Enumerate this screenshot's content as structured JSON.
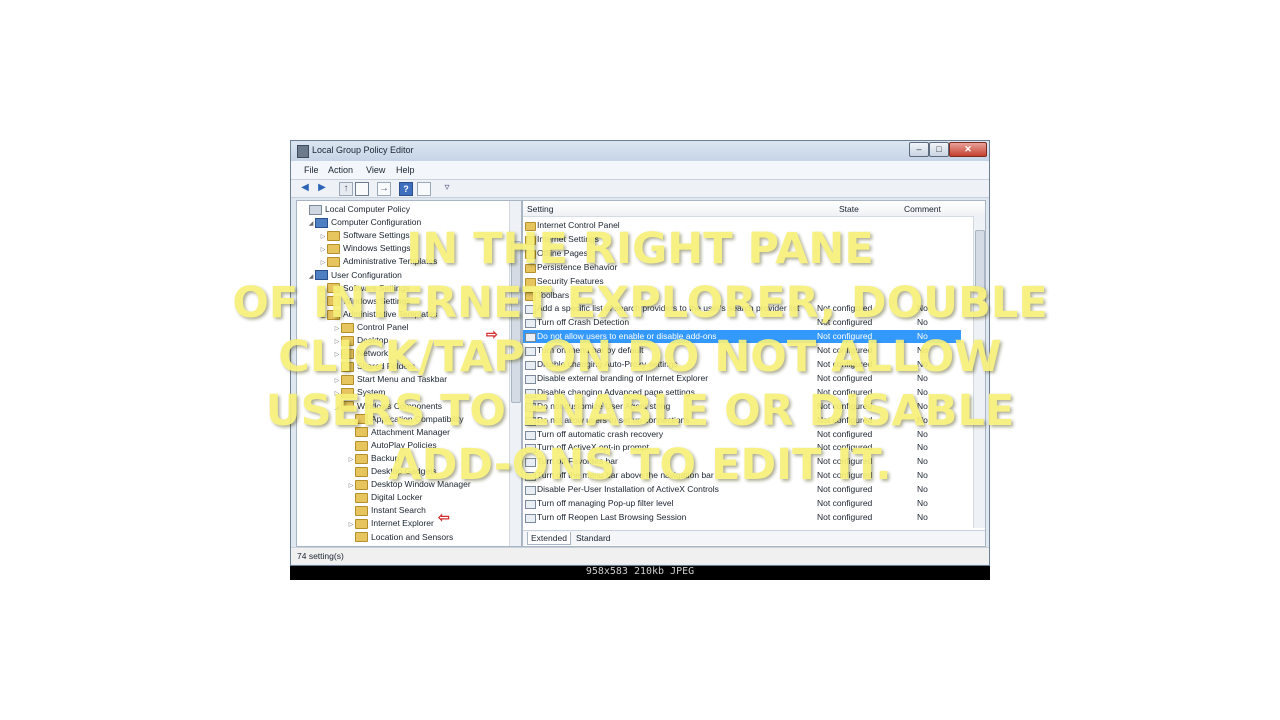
{
  "window": {
    "title": "Local Group Policy Editor",
    "controls": {
      "minimize": "–",
      "maximize": "□",
      "close": "✕"
    }
  },
  "menubar": {
    "items": [
      "File",
      "Action",
      "View",
      "Help"
    ]
  },
  "toolbar": {
    "icons": [
      "back-arrow-icon",
      "forward-arrow-icon",
      "up-folder-icon",
      "show-hide-tree-icon",
      "export-list-icon",
      "help-icon",
      "view-icon",
      "filter-icon"
    ]
  },
  "tree": {
    "nodes": [
      {
        "label": "Local Computer Policy",
        "expander": "",
        "icon": "policy"
      },
      {
        "label": "Computer Configuration",
        "expander": "◢",
        "icon": "computer"
      },
      {
        "label": "Software Settings",
        "expander": "▷",
        "icon": "folder"
      },
      {
        "label": "Windows Settings",
        "expander": "▷",
        "icon": "folder"
      },
      {
        "label": "Administrative Templates",
        "expander": "▷",
        "icon": "folder"
      },
      {
        "label": "User Configuration",
        "expander": "◢",
        "icon": "computer"
      },
      {
        "label": "Software Settings",
        "expander": "▷",
        "icon": "folder"
      },
      {
        "label": "Windows Settings",
        "expander": "▷",
        "icon": "folder"
      },
      {
        "label": "Administrative Templates",
        "expander": "◢",
        "icon": "folder"
      },
      {
        "label": "Control Panel",
        "expander": "▷",
        "icon": "folder"
      },
      {
        "label": "Desktop",
        "expander": "▷",
        "icon": "folder"
      },
      {
        "label": "Network",
        "expander": "▷",
        "icon": "folder"
      },
      {
        "label": "Shared Folders",
        "expander": "",
        "icon": "folder"
      },
      {
        "label": "Start Menu and Taskbar",
        "expander": "▷",
        "icon": "folder"
      },
      {
        "label": "System",
        "expander": "▷",
        "icon": "folder"
      },
      {
        "label": "Windows Components",
        "expander": "◢",
        "icon": "folder"
      },
      {
        "label": "Application Compatibility",
        "expander": "",
        "icon": "folder"
      },
      {
        "label": "Attachment Manager",
        "expander": "",
        "icon": "folder"
      },
      {
        "label": "AutoPlay Policies",
        "expander": "",
        "icon": "folder"
      },
      {
        "label": "Backup",
        "expander": "▷",
        "icon": "folder"
      },
      {
        "label": "Desktop Gadgets",
        "expander": "",
        "icon": "folder"
      },
      {
        "label": "Desktop Window Manager",
        "expander": "▷",
        "icon": "folder"
      },
      {
        "label": "Digital Locker",
        "expander": "",
        "icon": "folder"
      },
      {
        "label": "Instant Search",
        "expander": "",
        "icon": "folder"
      },
      {
        "label": "Internet Explorer",
        "expander": "▷",
        "icon": "folder"
      },
      {
        "label": "Location and Sensors",
        "expander": "",
        "icon": "folder"
      }
    ]
  },
  "list": {
    "headers": {
      "setting": "Setting",
      "state": "State",
      "comment": "Comment"
    },
    "rows": [
      {
        "setting": "Internet Control Panel",
        "state": "",
        "comment": "",
        "type": "folder"
      },
      {
        "setting": "Internet Settings",
        "state": "",
        "comment": "",
        "type": "folder"
      },
      {
        "setting": "Offline Pages",
        "state": "",
        "comment": "",
        "type": "folder"
      },
      {
        "setting": "Persistence Behavior",
        "state": "",
        "comment": "",
        "type": "folder"
      },
      {
        "setting": "Security Features",
        "state": "",
        "comment": "",
        "type": "folder"
      },
      {
        "setting": "Toolbars",
        "state": "",
        "comment": "",
        "type": "folder"
      },
      {
        "setting": "Add a specific list of search providers to the user's search provider list",
        "state": "Not configured",
        "comment": "No",
        "type": "setting"
      },
      {
        "setting": "Turn off Crash Detection",
        "state": "Not configured",
        "comment": "No",
        "type": "setting"
      },
      {
        "setting": "Do not allow users to enable or disable add-ons",
        "state": "Not configured",
        "comment": "No",
        "type": "setting",
        "selected": true
      },
      {
        "setting": "Turn on menu bar by default",
        "state": "Not configured",
        "comment": "No",
        "type": "setting"
      },
      {
        "setting": "Disable changing Auto-Proxy settings",
        "state": "Not configured",
        "comment": "No",
        "type": "setting"
      },
      {
        "setting": "Disable external branding of Internet Explorer",
        "state": "Not configured",
        "comment": "No",
        "type": "setting"
      },
      {
        "setting": "Disable changing Advanced page settings",
        "state": "Not configured",
        "comment": "No",
        "type": "setting"
      },
      {
        "setting": "Do not customize User Agent string",
        "state": "Not configured",
        "comment": "No",
        "type": "setting"
      },
      {
        "setting": "Do not allow users to set up connections",
        "state": "Not configured",
        "comment": "No",
        "type": "setting"
      },
      {
        "setting": "Turn off automatic crash recovery",
        "state": "Not configured",
        "comment": "No",
        "type": "setting"
      },
      {
        "setting": "Turn off ActiveX opt-in prompt",
        "state": "Not configured",
        "comment": "No",
        "type": "setting"
      },
      {
        "setting": "Turn off Favorites bar",
        "state": "Not configured",
        "comment": "No",
        "type": "setting"
      },
      {
        "setting": "Turn off the menu bar above the navigation bar",
        "state": "Not configured",
        "comment": "No",
        "type": "setting"
      },
      {
        "setting": "Disable Per-User Installation of ActiveX Controls",
        "state": "Not configured",
        "comment": "No",
        "type": "setting"
      },
      {
        "setting": "Turn off managing Pop-up filter level",
        "state": "Not configured",
        "comment": "No",
        "type": "setting"
      },
      {
        "setting": "Turn off Reopen Last Browsing Session",
        "state": "Not configured",
        "comment": "No",
        "type": "setting"
      }
    ],
    "tabs": [
      "Extended",
      "Standard"
    ]
  },
  "status": {
    "text": "74 setting(s)"
  },
  "image_info": "958x583  210kb  JPEG",
  "caption": {
    "lines": [
      "IN THE RIGHT PANE",
      "OF INTERNET EXPLORER,  DOUBLE",
      "CLICK/TAP ON DO NOT ALLOW",
      "USERS TO ENABLE OR DISABLE",
      "ADD-ONS TO EDIT IT."
    ],
    "color": "#f7f07a"
  },
  "colors": {
    "selection": "#3399ff",
    "arrow": "#d43030"
  }
}
